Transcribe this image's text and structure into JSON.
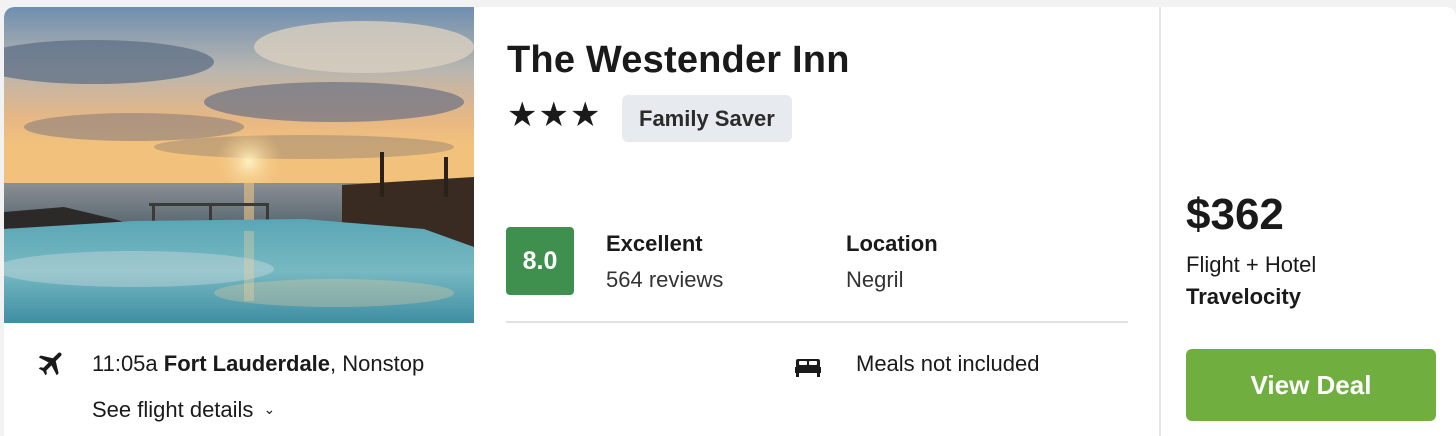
{
  "hotel": {
    "name": "The Westender Inn",
    "stars": "★★★",
    "star_rating": 3,
    "badge": "Family Saver"
  },
  "rating": {
    "score": "8.0",
    "label": "Excellent",
    "reviews": "564 reviews"
  },
  "location": {
    "label": "Location",
    "value": "Negril"
  },
  "flight": {
    "time": "11:05a",
    "origin": "Fort Lauderdale",
    "stops": ", Nonstop",
    "details_link": "See flight details",
    "icon": "airplane-icon"
  },
  "amenity": {
    "meals": "Meals not included",
    "icon": "bed-icon"
  },
  "deal": {
    "price": "$362",
    "package": "Flight + Hotel",
    "provider": "Travelocity",
    "button": "View Deal"
  },
  "colors": {
    "score_bg": "#3f8f4f",
    "button_bg": "#6fae3f",
    "badge_bg": "#e7eaee"
  }
}
